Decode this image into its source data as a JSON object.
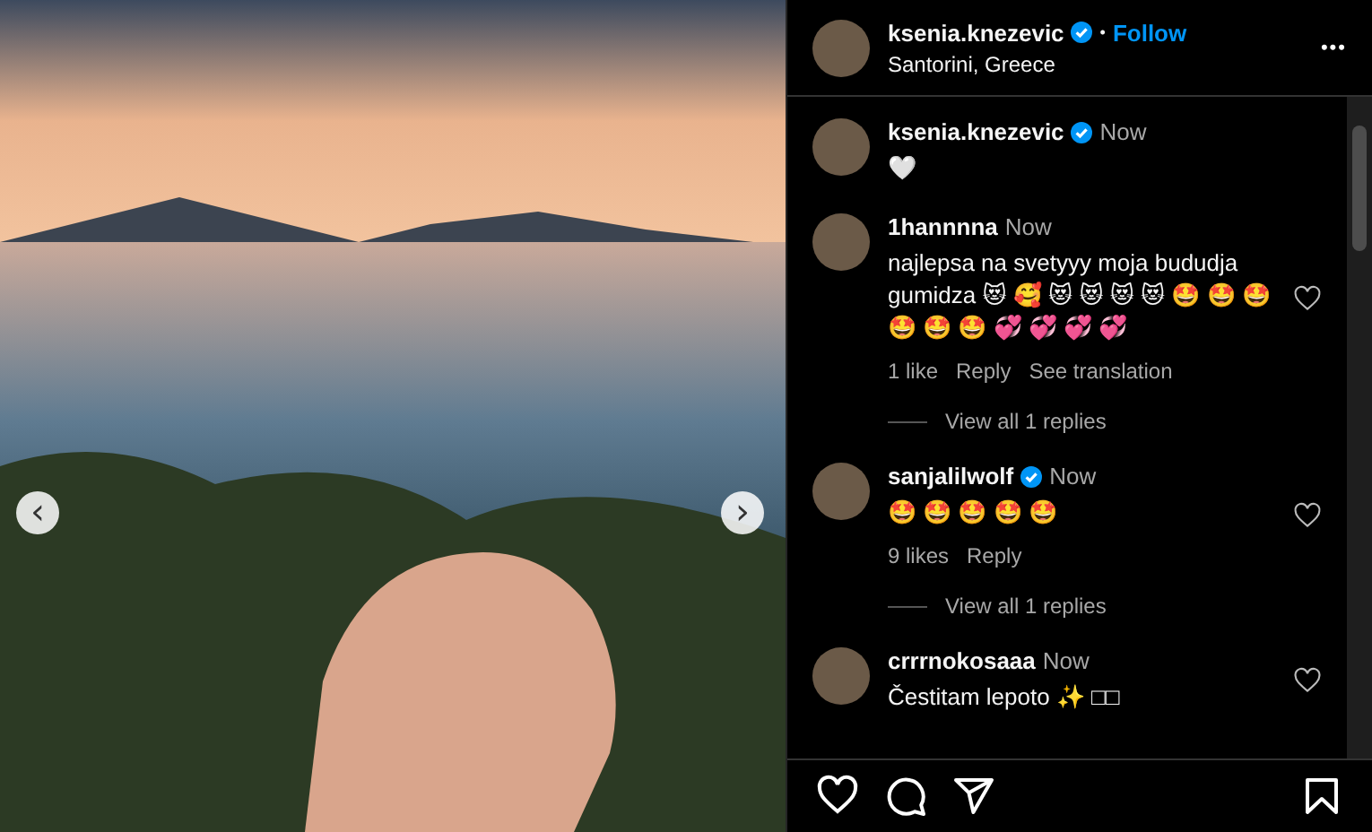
{
  "photo": {
    "prev_label": "‹",
    "next_label": "›"
  },
  "header": {
    "username": "ksenia.knezevic",
    "verified": true,
    "separator": "•",
    "follow": "Follow",
    "location": "Santorini, Greece",
    "more": "•••"
  },
  "comments": [
    {
      "kind": "comment",
      "username": "ksenia.knezevic",
      "verified": true,
      "time": "Now",
      "text": "🤍",
      "likeable": false
    },
    {
      "kind": "comment",
      "username": "1hannnna",
      "verified": false,
      "time": "Now",
      "text": "najlepsa na svetyyy moja bududja gumidza 😻 🥰 😻 😻 😻 😻 🤩 🤩 🤩 🤩 🤩 🤩 💞 💞 💞 💞",
      "likeable": true,
      "likes": "1 like",
      "reply": "Reply",
      "translate": "See translation"
    },
    {
      "kind": "replies",
      "label": "View all 1 replies"
    },
    {
      "kind": "comment",
      "username": "sanjalilwolf",
      "verified": true,
      "time": "Now",
      "text": "🤩 🤩 🤩 🤩 🤩",
      "likeable": true,
      "likes": "9 likes",
      "reply": "Reply"
    },
    {
      "kind": "replies",
      "label": "View all 1 replies"
    },
    {
      "kind": "comment",
      "username": "crrrnokosaaa",
      "verified": false,
      "time": "Now",
      "text": "Čestitam lepoto ✨ □□",
      "likeable": true
    }
  ]
}
